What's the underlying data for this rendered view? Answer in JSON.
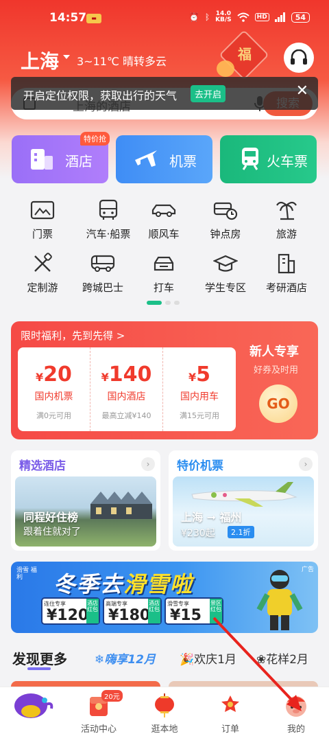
{
  "status": {
    "time": "14:57",
    "speed_value": "14.0",
    "speed_unit": "KB/S",
    "hd": "HD",
    "battery": "54"
  },
  "header": {
    "city": "上海",
    "weather": "3~11℃ 晴转多云",
    "fu": "福"
  },
  "search": {
    "placeholder": "上海的酒店",
    "button": "搜索"
  },
  "toast": {
    "message": "开启定位权限，获取出行的天气",
    "action": "去开启"
  },
  "tiles": [
    {
      "label": "酒店",
      "tag": "特价抢"
    },
    {
      "label": "机票"
    },
    {
      "label": "火车票"
    }
  ],
  "grid": [
    {
      "label": "门票",
      "icon": "ticket-icon"
    },
    {
      "label": "汽车·船票",
      "icon": "bus-icon"
    },
    {
      "label": "顺风车",
      "icon": "car-icon"
    },
    {
      "label": "钟点房",
      "icon": "hourly-room-icon"
    },
    {
      "label": "旅游",
      "icon": "palm-tree-icon"
    },
    {
      "label": "定制游",
      "icon": "custom-tour-icon"
    },
    {
      "label": "跨城巴士",
      "icon": "intercity-bus-icon"
    },
    {
      "label": "打车",
      "icon": "taxi-icon"
    },
    {
      "label": "学生专区",
      "icon": "graduation-cap-icon"
    },
    {
      "label": "考研酒店",
      "icon": "building-icon"
    }
  ],
  "coupon": {
    "header": "限时福利，先到先得 >",
    "items": [
      {
        "currency": "¥",
        "amount": "20",
        "name": "国内机票",
        "cond": "满0元可用"
      },
      {
        "currency": "¥",
        "amount": "140",
        "name": "国内酒店",
        "cond": "最高立减¥140"
      },
      {
        "currency": "¥",
        "amount": "5",
        "name": "国内用车",
        "cond": "满15元可用"
      }
    ],
    "newbie_title": "新人专享",
    "newbie_sub": "好券及时用",
    "go": "GO"
  },
  "cards": {
    "hotel": {
      "title": "精选酒店",
      "line1": "同程好住榜",
      "line2": "跟着住就对了",
      "more": "›"
    },
    "flight": {
      "title": "特价机票",
      "route": "上海 ➞ 福州",
      "price": "¥230起",
      "discount": "2.1折",
      "more": "›"
    }
  },
  "ski": {
    "tag": "滑雪 福利",
    "title_a": "冬季去",
    "title_b": "滑雪啦",
    "coupons": [
      {
        "kind": "连住专享",
        "value": "¥120",
        "side": "酒店红包"
      },
      {
        "kind": "高端专享",
        "value": "¥180",
        "side": "酒店红包"
      },
      {
        "kind": "滑雪专享",
        "value": "¥15",
        "side": "景区红包"
      }
    ],
    "ad": "广告"
  },
  "discover": {
    "main": "发现更多",
    "tabs": [
      "❄嗨享12月",
      "🎉欢庆1月",
      "❀花样2月"
    ]
  },
  "bottom_nav": [
    {
      "label": "",
      "icon": "mascot-icon"
    },
    {
      "label": "活动中心",
      "icon": "gift-icon",
      "badge": "20元"
    },
    {
      "label": "逛本地",
      "icon": "lantern-icon"
    },
    {
      "label": "订单",
      "icon": "order-icon"
    },
    {
      "label": "我的",
      "icon": "profile-icon"
    }
  ],
  "colors": {
    "brand_red": "#f0362c",
    "accent_green": "#1bbf88",
    "annotation_red": "#e8231d"
  }
}
